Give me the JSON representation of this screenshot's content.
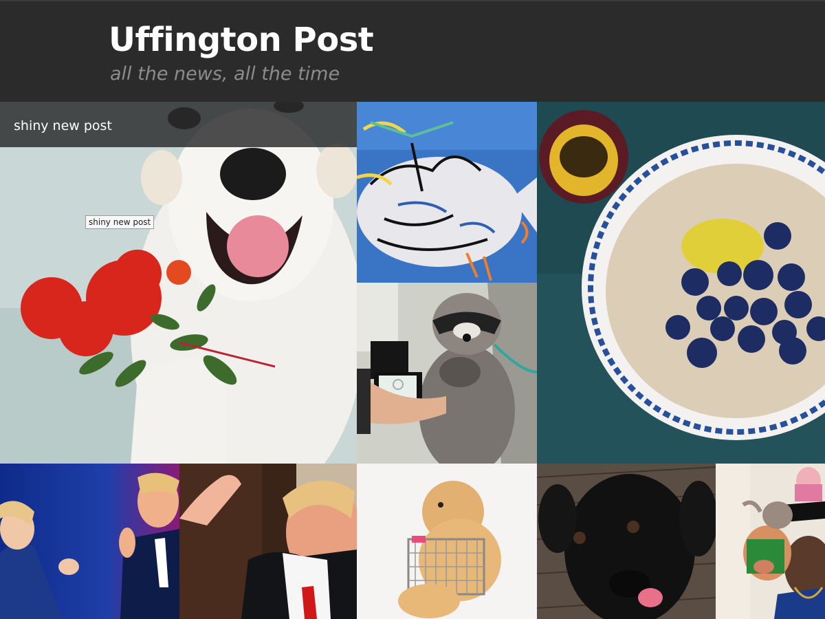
{
  "site": {
    "title": "Uffington Post",
    "tagline": "all the news, all the time"
  },
  "featured_post": {
    "caption": "shiny new post",
    "tooltip": "shiny new post"
  },
  "colors": {
    "header_bg": "#2b2b2b",
    "title": "#ffffff",
    "tagline": "#8c8c8c"
  }
}
